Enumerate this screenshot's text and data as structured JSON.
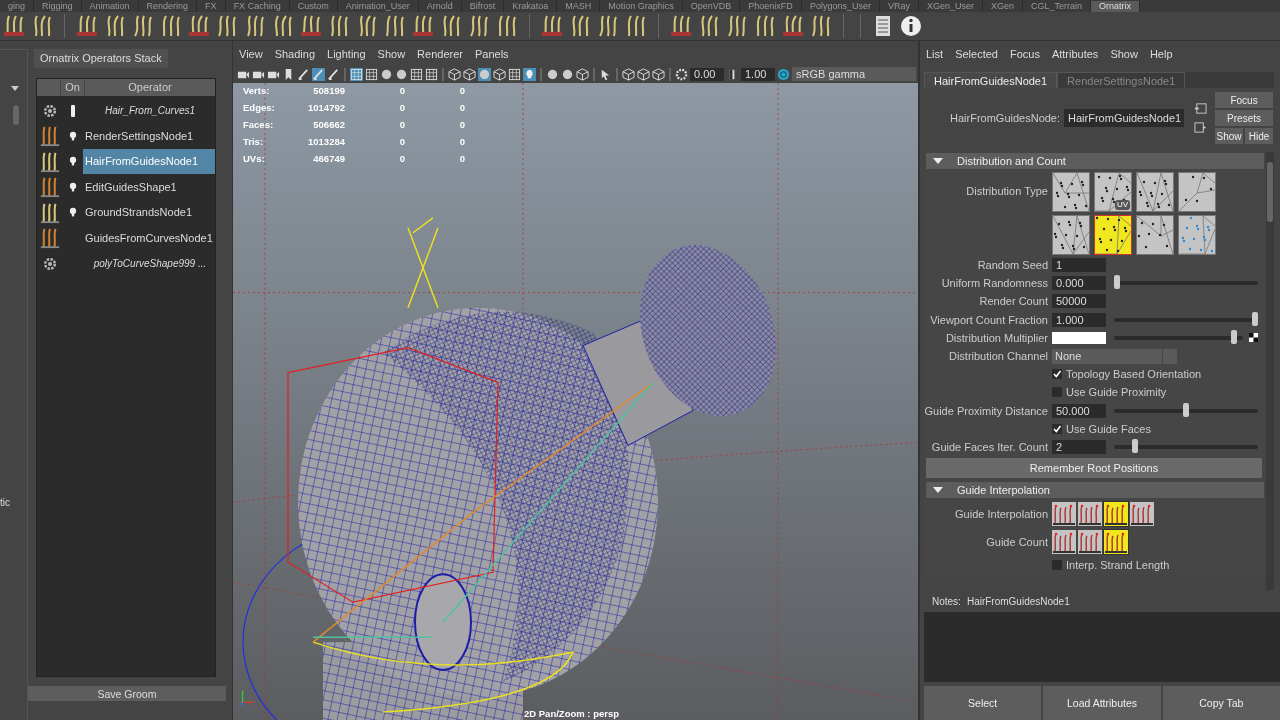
{
  "shelf_tabs": [
    {
      "label": "ging",
      "selected": false
    },
    {
      "label": "Rigging",
      "selected": false
    },
    {
      "label": "Animation",
      "selected": false
    },
    {
      "label": "Rendering",
      "selected": false
    },
    {
      "label": "FX",
      "selected": false
    },
    {
      "label": "FX Caching",
      "selected": false
    },
    {
      "label": "Custom",
      "selected": false
    },
    {
      "label": "Animation_User",
      "selected": false
    },
    {
      "label": "Arnold",
      "selected": false
    },
    {
      "label": "Bifrost",
      "selected": false
    },
    {
      "label": "Krakatoa",
      "selected": false
    },
    {
      "label": "MASH",
      "selected": false
    },
    {
      "label": "Motion Graphics",
      "selected": false
    },
    {
      "label": "OpenVDB",
      "selected": false
    },
    {
      "label": "PhoenixFD",
      "selected": false
    },
    {
      "label": "Polygons_User",
      "selected": false
    },
    {
      "label": "VRay",
      "selected": false
    },
    {
      "label": "XGen_User",
      "selected": false
    },
    {
      "label": "XGen",
      "selected": false
    },
    {
      "label": "CGL_Terrain",
      "selected": false
    },
    {
      "label": "Ornatrix",
      "selected": true
    }
  ],
  "left_strip": {
    "label": "tic"
  },
  "operators_panel": {
    "title": "Ornatrix Operators Stack",
    "columns": [
      "On",
      "Operator"
    ],
    "rows": [
      {
        "kind": "gear",
        "on": true,
        "name": "Hair_From_Curves1",
        "selected": false
      },
      {
        "kind": "strands",
        "on": true,
        "name": "RenderSettingsNode1",
        "selected": false
      },
      {
        "kind": "strands",
        "on": true,
        "name": "HairFromGuidesNode1",
        "selected": true
      },
      {
        "kind": "strands",
        "on": true,
        "name": "EditGuidesShape1",
        "selected": false
      },
      {
        "kind": "strands",
        "on": true,
        "name": "GroundStrandsNode1",
        "selected": false
      },
      {
        "kind": "strands",
        "on": false,
        "name": "GuidesFromCurvesNode1",
        "selected": false
      },
      {
        "kind": "gear",
        "on": false,
        "name": "polyToCurveShape999 ...",
        "selected": false
      }
    ],
    "save_button": "Save Groom"
  },
  "viewport": {
    "menu": [
      "View",
      "Shading",
      "Lighting",
      "Show",
      "Renderer",
      "Panels"
    ],
    "exposure": "0.00",
    "gamma": "1.00",
    "color_space": "sRGB gamma",
    "stats": [
      {
        "label": "Verts:",
        "values": [
          "508199",
          "0",
          "0"
        ]
      },
      {
        "label": "Edges:",
        "values": [
          "1014792",
          "0",
          "0"
        ]
      },
      {
        "label": "Faces:",
        "values": [
          "506662",
          "0",
          "0"
        ]
      },
      {
        "label": "Tris:",
        "values": [
          "1013284",
          "0",
          "0"
        ]
      },
      {
        "label": "UVs:",
        "values": [
          "466749",
          "0",
          "0"
        ]
      }
    ],
    "camera_label": "2D Pan/Zoom : persp"
  },
  "attribute_editor": {
    "menu": [
      "List",
      "Selected",
      "Focus",
      "Attributes",
      "Show",
      "Help"
    ],
    "tabs": [
      {
        "label": "HairFromGuidesNode1",
        "selected": true
      },
      {
        "label": "RenderSettingsNode1",
        "selected": false
      }
    ],
    "node_label": "HairFromGuidesNode:",
    "node_value": "HairFromGuidesNode1",
    "buttons": [
      "Focus",
      "Presets",
      "Show",
      "Hide"
    ],
    "sections": [
      {
        "title": "Distribution and Count",
        "expanded": true,
        "rows": [
          {
            "kind": "icons",
            "label": "Distribution Type",
            "icons": [
              {
                "selected": false
              },
              {
                "selected": false,
                "badge": "UV"
              },
              {
                "selected": false
              },
              {
                "selected": false
              },
              {
                "selected": false
              },
              {
                "selected": true
              },
              {
                "selected": false
              },
              {
                "selected": false
              }
            ]
          },
          {
            "kind": "field",
            "label": "Random Seed",
            "value": "1"
          },
          {
            "kind": "slider",
            "label": "Uniform Randomness",
            "value": "0.000",
            "level": 0
          },
          {
            "kind": "field",
            "label": "Render Count",
            "value": "50000"
          },
          {
            "kind": "slider",
            "label": "Viewport Count Fraction",
            "value": "1.000",
            "level": 1
          },
          {
            "kind": "color",
            "label": "Distribution Multiplier",
            "level": 0.95
          },
          {
            "kind": "dropdown",
            "label": "Distribution Channel",
            "value": "None"
          },
          {
            "kind": "checkbox",
            "label": "Topology Based Orientation",
            "checked": true
          },
          {
            "kind": "checkbox",
            "label": "Use Guide Proximity",
            "checked": false
          },
          {
            "kind": "slider",
            "label": "Guide Proximity Distance",
            "value": "50.000",
            "level": 0.5
          },
          {
            "kind": "checkbox",
            "label": "Use Guide Faces",
            "checked": true
          },
          {
            "kind": "slider",
            "label": "Guide Faces Iter. Count",
            "value": "2",
            "level": 0.13
          },
          {
            "kind": "button",
            "label": "Remember Root Positions"
          }
        ]
      },
      {
        "title": "Guide Interpolation",
        "expanded": true,
        "rows": [
          {
            "kind": "strand_icons",
            "label": "Guide Interpolation",
            "icons": [
              {
                "selected": false
              },
              {
                "selected": false
              },
              {
                "selected": true
              },
              {
                "selected": false
              }
            ]
          },
          {
            "kind": "strand_icons",
            "label": "Guide Count",
            "icons": [
              {
                "selected": false
              },
              {
                "selected": false
              },
              {
                "selected": true
              }
            ]
          },
          {
            "kind": "checkbox",
            "label": "Interp. Strand Length",
            "checked": false
          }
        ]
      }
    ],
    "notes_label": "Notes:",
    "notes_node": "HairFromGuidesNode1",
    "bottom_buttons": [
      "Select",
      "Load Attributes",
      "Copy Tab"
    ]
  }
}
